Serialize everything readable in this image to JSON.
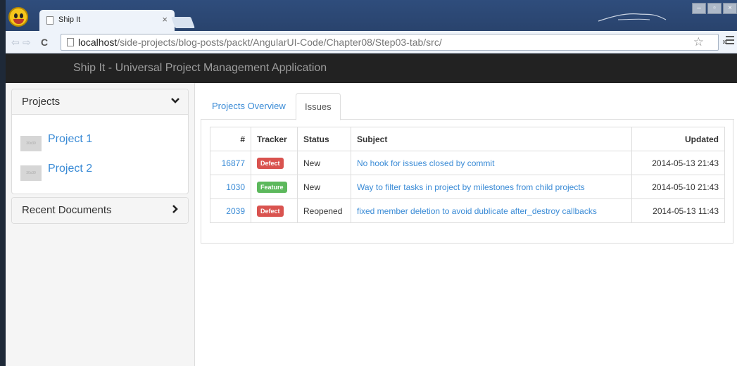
{
  "browser": {
    "tab_title": "Ship It",
    "tab_close": "×",
    "url_host": "localhost",
    "url_path": "/side-projects/blog-posts/packt/AngularUI-Code/Chapter08/Step03-tab/src/",
    "window_buttons": [
      "–",
      "▫",
      "×"
    ]
  },
  "app": {
    "title": "Ship It - Universal Project Management Application"
  },
  "sidebar": {
    "projects_heading": "Projects",
    "projects": [
      {
        "name": "Project 1",
        "thumb": "30x30"
      },
      {
        "name": "Project 2",
        "thumb": "30x30"
      }
    ],
    "recent_documents_heading": "Recent Documents"
  },
  "tabs": [
    {
      "label": "Projects Overview",
      "active": false
    },
    {
      "label": "Issues",
      "active": true
    }
  ],
  "issues_table": {
    "headers": [
      "#",
      "Tracker",
      "Status",
      "Subject",
      "Updated"
    ],
    "rows": [
      {
        "id": "16877",
        "tracker": "Defect",
        "status": "New",
        "subject": "No hook for issues closed by commit",
        "updated": "2014-05-13 21:43"
      },
      {
        "id": "1030",
        "tracker": "Feature",
        "status": "New",
        "subject": "Way to filter tasks in project by milestones from child projects",
        "updated": "2014-05-10 21:43"
      },
      {
        "id": "2039",
        "tracker": "Defect",
        "status": "Reopened",
        "subject": "fixed member deletion to avoid dublicate after_destroy callbacks",
        "updated": "2014-05-13 11:43"
      }
    ]
  },
  "colors": {
    "defect_label": "#d9534f",
    "feature_label": "#5cb85c",
    "link": "#3a8bd6",
    "navbar": "#222222"
  }
}
